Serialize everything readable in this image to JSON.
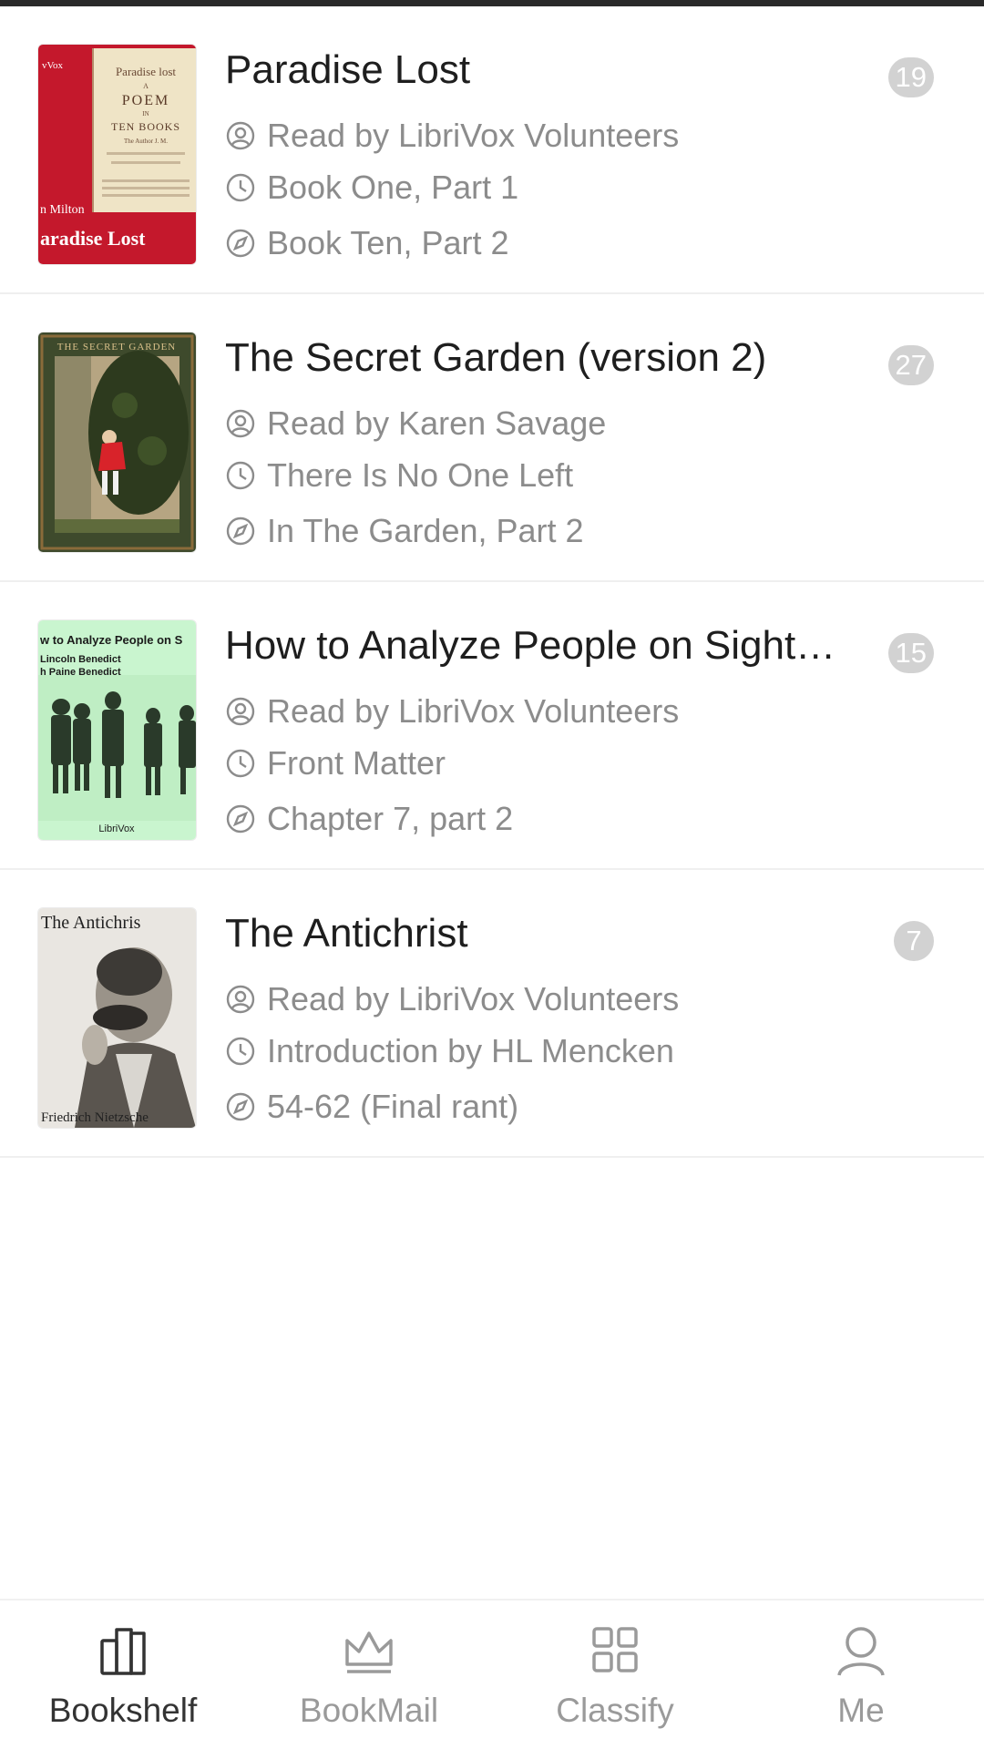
{
  "books": [
    {
      "title": "Paradise Lost",
      "count": "19",
      "reader": "Read by LibriVox Volunteers",
      "history": "Book One, Part 1",
      "latest": "Book Ten, Part 2",
      "cover": {
        "lines": [
          "Paradise lost",
          "A",
          "POEM",
          "IN",
          "TEN BOOKS",
          "The Author J. M."
        ],
        "author": "n Milton",
        "title": "aradise Lost",
        "side": "vVox"
      }
    },
    {
      "title": "The Secret Garden (version 2)",
      "count": "27",
      "reader": "Read by Karen Savage",
      "history": "There Is No One Left",
      "latest": "In The Garden, Part 2",
      "cover": {
        "title": "THE SECRET GARDEN"
      }
    },
    {
      "title": "How to Analyze People on Sight…",
      "count": "15",
      "reader": "Read by LibriVox Volunteers",
      "history": "Front Matter",
      "latest": "Chapter 7, part 2",
      "cover": {
        "title": "w to Analyze People on S",
        "authors": [
          "Lincoln Benedict",
          "h Paine Benedict"
        ],
        "publisher": "LibriVox"
      }
    },
    {
      "title": "The Antichrist",
      "count": "7",
      "reader": "Read by LibriVox Volunteers",
      "history": "Introduction by HL Mencken",
      "latest": "54-62 (Final rant)",
      "cover": {
        "title": "The Antichris",
        "author": "Friedrich Nietzsche"
      }
    }
  ],
  "icons": {
    "reader": "user-circle-icon",
    "history": "clock-icon",
    "latest": "compass-icon"
  },
  "tabs": [
    {
      "label": "Bookshelf",
      "icon": "bookshelf-icon",
      "active": true
    },
    {
      "label": "BookMail",
      "icon": "crown-icon",
      "active": false
    },
    {
      "label": "Classify",
      "icon": "grid-icon",
      "active": false
    },
    {
      "label": "Me",
      "icon": "person-icon",
      "active": false
    }
  ],
  "colors": {
    "badge": "#d2d2d2",
    "meta_text": "#8c8c8c",
    "tab_active": "#333333",
    "tab_inactive": "#9a9a9a"
  }
}
